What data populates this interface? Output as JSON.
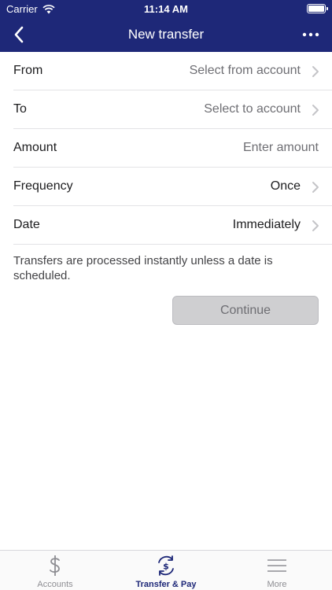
{
  "status_bar": {
    "carrier": "Carrier",
    "time": "11:14 AM",
    "battery_icon": "battery-icon",
    "wifi_icon": "wifi-icon"
  },
  "nav": {
    "title": "New transfer",
    "back_icon": "chevron-left-icon",
    "more_icon": "ellipsis-icon"
  },
  "colors": {
    "brand": "#1e2878",
    "disabled_button": "#cfcfd1",
    "muted_text": "#6e6e73"
  },
  "form": {
    "rows": [
      {
        "label": "From",
        "value": "Select from account"
      },
      {
        "label": "To",
        "value": "Select to account"
      },
      {
        "label": "Amount",
        "placeholder": "Enter amount"
      },
      {
        "label": "Frequency",
        "value": "Once"
      },
      {
        "label": "Date",
        "value": "Immediately"
      }
    ]
  },
  "info_text": "Transfers are processed instantly unless a date is scheduled.",
  "continue_label": "Continue",
  "tabs": [
    {
      "label": "Accounts",
      "icon": "dollar-icon"
    },
    {
      "label": "Transfer & Pay",
      "icon": "transfer-icon",
      "active": true
    },
    {
      "label": "More",
      "icon": "menu-icon"
    }
  ]
}
